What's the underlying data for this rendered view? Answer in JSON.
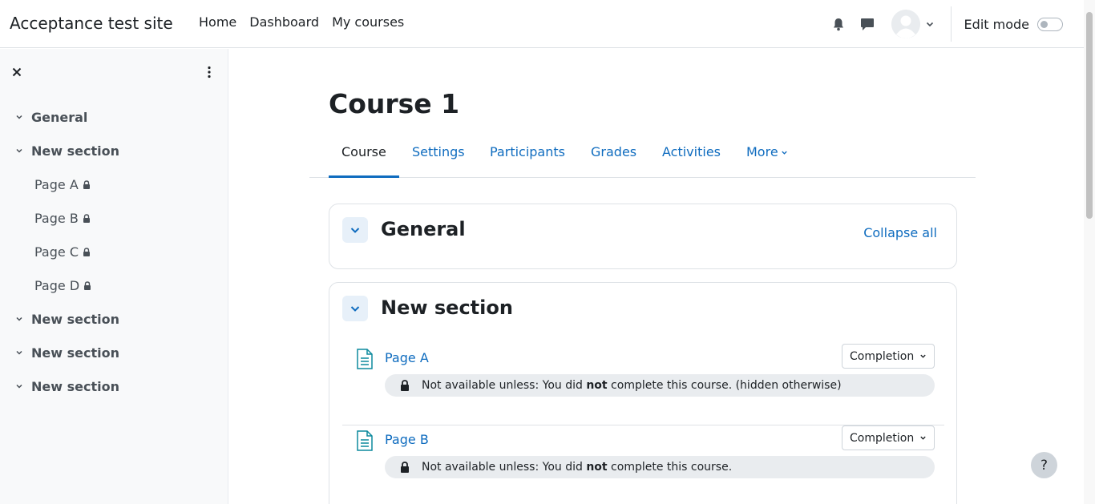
{
  "navbar": {
    "site_name": "Acceptance test site",
    "links": [
      "Home",
      "Dashboard",
      "My courses"
    ],
    "edit_mode_label": "Edit mode",
    "icons": [
      "bell-icon",
      "chat-icon",
      "avatar-icon"
    ]
  },
  "drawer": {
    "items": [
      {
        "type": "section",
        "label": "General"
      },
      {
        "type": "section",
        "label": "New section"
      },
      {
        "type": "page",
        "label": "Page A"
      },
      {
        "type": "page",
        "label": "Page B"
      },
      {
        "type": "page",
        "label": "Page C"
      },
      {
        "type": "page",
        "label": "Page D"
      },
      {
        "type": "section",
        "label": "New section"
      },
      {
        "type": "section",
        "label": "New section"
      },
      {
        "type": "section",
        "label": "New section"
      }
    ]
  },
  "page": {
    "title": "Course 1",
    "tabs": [
      "Course",
      "Settings",
      "Participants",
      "Grades",
      "Activities",
      "More"
    ],
    "active_tab": "Course"
  },
  "course": {
    "general_section": {
      "name": "General",
      "collapse_all": "Collapse all"
    },
    "new_section": {
      "name": "New section",
      "activities": [
        {
          "name": "Page A",
          "completion": "Completion",
          "availability": {
            "prefix": "Not available unless: You did ",
            "bold": "not",
            "suffix": " complete this course. (hidden otherwise)"
          }
        },
        {
          "name": "Page B",
          "completion": "Completion",
          "availability": {
            "prefix": "Not available unless: You did ",
            "bold": "not",
            "suffix": " complete this course."
          }
        }
      ]
    }
  },
  "help": {
    "label": "?"
  },
  "colors": {
    "link": "#0f6cbf",
    "text": "#1d2125",
    "drawer_bg": "#f8f9fa",
    "pill_bg": "#e9ecef",
    "icon_teal": "#0d8a9e"
  }
}
